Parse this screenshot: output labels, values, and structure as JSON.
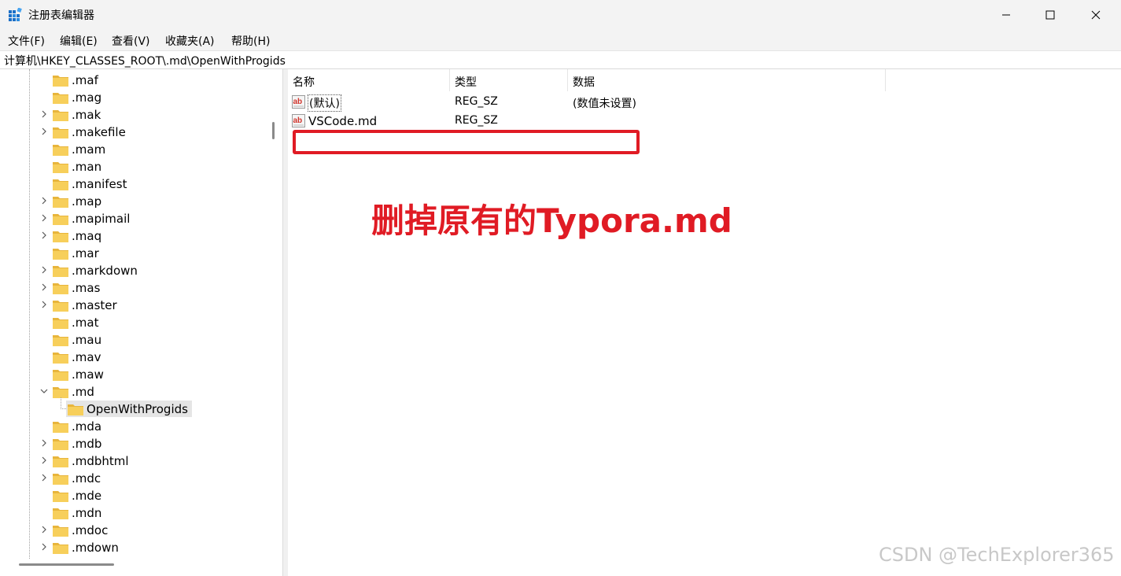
{
  "window": {
    "title": "注册表编辑器",
    "controls": {
      "minimize": "minimize-icon",
      "maximize": "maximize-icon",
      "close": "close-icon"
    }
  },
  "menu": [
    "文件(F)",
    "编辑(E)",
    "查看(V)",
    "收藏夹(A)",
    "帮助(H)"
  ],
  "address": "计算机\\HKEY_CLASSES_ROOT\\.md\\OpenWithProgids",
  "tree": {
    "items": [
      {
        "label": ".maf",
        "expander": "none"
      },
      {
        "label": ".mag",
        "expander": "none"
      },
      {
        "label": ".mak",
        "expander": "collapsed"
      },
      {
        "label": ".makefile",
        "expander": "collapsed"
      },
      {
        "label": ".mam",
        "expander": "none"
      },
      {
        "label": ".man",
        "expander": "none"
      },
      {
        "label": ".manifest",
        "expander": "none"
      },
      {
        "label": ".map",
        "expander": "collapsed"
      },
      {
        "label": ".mapimail",
        "expander": "collapsed"
      },
      {
        "label": ".maq",
        "expander": "collapsed"
      },
      {
        "label": ".mar",
        "expander": "none"
      },
      {
        "label": ".markdown",
        "expander": "collapsed"
      },
      {
        "label": ".mas",
        "expander": "collapsed"
      },
      {
        "label": ".master",
        "expander": "collapsed"
      },
      {
        "label": ".mat",
        "expander": "none"
      },
      {
        "label": ".mau",
        "expander": "none"
      },
      {
        "label": ".mav",
        "expander": "none"
      },
      {
        "label": ".maw",
        "expander": "none"
      },
      {
        "label": ".md",
        "expander": "expanded"
      },
      {
        "label": "OpenWithProgids",
        "expander": "none",
        "child": true,
        "selected": true
      },
      {
        "label": ".mda",
        "expander": "none"
      },
      {
        "label": ".mdb",
        "expander": "collapsed"
      },
      {
        "label": ".mdbhtml",
        "expander": "collapsed"
      },
      {
        "label": ".mdc",
        "expander": "collapsed"
      },
      {
        "label": ".mde",
        "expander": "none"
      },
      {
        "label": ".mdn",
        "expander": "none"
      },
      {
        "label": ".mdoc",
        "expander": "collapsed"
      },
      {
        "label": ".mdown",
        "expander": "collapsed"
      }
    ]
  },
  "list": {
    "columns": [
      "名称",
      "类型",
      "数据"
    ],
    "rows": [
      {
        "name": "(默认)",
        "type": "REG_SZ",
        "data": "(数值未设置)",
        "icon": "string-value-icon"
      },
      {
        "name": "VSCode.md",
        "type": "REG_SZ",
        "data": "",
        "icon": "string-value-icon"
      }
    ]
  },
  "annotation": "删掉原有的Typora.md",
  "watermark": "CSDN @TechExplorer365",
  "colors": {
    "annotation": "#e01b24",
    "folder": "#f7cf5b",
    "selection": "#e5e5e5"
  }
}
